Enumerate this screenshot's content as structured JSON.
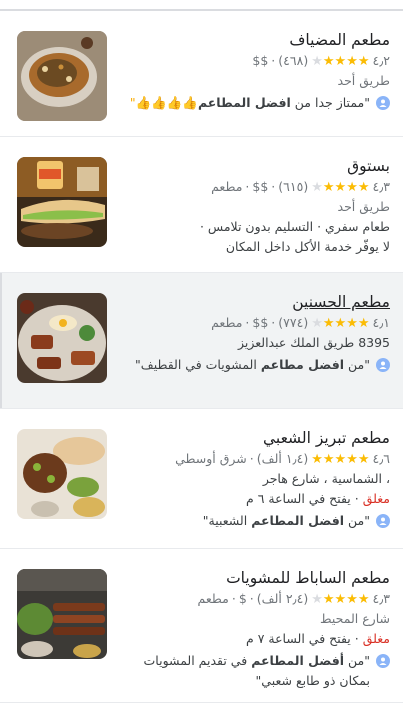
{
  "places": [
    {
      "name": "مطعم المضياف",
      "rating": "٤٫٢",
      "reviews": "(٤٦٨)",
      "price": "$$",
      "category": "",
      "address": "طريق أحد",
      "extra": [],
      "status": "",
      "review_pre": "\"ممتاز جدا من ",
      "review_bold": "افضل المطاعم",
      "review_post": "👍👍👍👍\"",
      "stars_full": 4
    },
    {
      "name": "بستوق",
      "rating": "٤٫٣",
      "reviews": "(٦١٥)",
      "price": "$$",
      "category": "مطعم",
      "address": "طريق أحد",
      "extra": [
        "طعام سفري · التسليم بدون تلامس ·",
        "لا يوفّر خدمة الأكل داخل المكان"
      ],
      "status": "",
      "review_pre": "",
      "review_bold": "",
      "review_post": "",
      "stars_full": 4
    },
    {
      "name": "مطعم الحسنين",
      "rating": "٤٫١",
      "reviews": "(٧٧٤)",
      "price": "$$",
      "category": "مطعم",
      "address": "8395 طريق الملك عبدالعزيز",
      "extra": [],
      "status": "",
      "review_pre": "\"من ",
      "review_bold": "افضل مطاعم",
      "review_post": " المشويات في القطيف\"",
      "stars_full": 4
    },
    {
      "name": "مطعم تبريز الشعبي",
      "rating": "٤٫٦",
      "reviews": "(١٫٤ ألف)",
      "price": "",
      "category": "شرق أوسطي",
      "address": "، الشماسية ، شارع هاجر",
      "extra": [],
      "status_closed": "مغلق",
      "status": " · يفتح في الساعة ٦ م",
      "review_pre": "\"من ",
      "review_bold": "افضل المطاعم",
      "review_post": " الشعبية\"",
      "stars_full": 5
    },
    {
      "name": "مطعم الساباط للمشويات",
      "rating": "٤٫٣",
      "reviews": "(٢٫٤ ألف)",
      "price": "$",
      "category": "مطعم",
      "address": "شارع المحيط",
      "extra": [],
      "status_closed": "مغلق",
      "status": " · يفتح في الساعة ٧ م",
      "review_pre": "\"من ",
      "review_bold": "أفضل المطاعم",
      "review_post": " في تقديم المشويات بمكان ذو طابع شعبي\"",
      "stars_full": 4
    }
  ],
  "colors": {
    "star": "#fbbc04",
    "closed": "#d93025",
    "text_secondary": "#70757a"
  }
}
